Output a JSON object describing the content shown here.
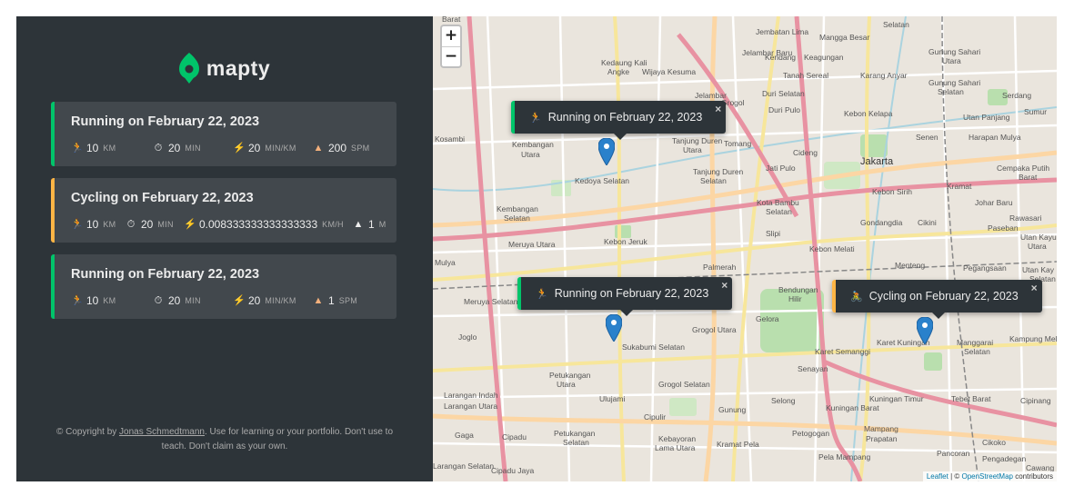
{
  "app": {
    "name": "mapty"
  },
  "colors": {
    "running": "#00c46a",
    "cycling": "#ffb545",
    "sidebar_bg": "#2d3439",
    "card_bg": "#42484d"
  },
  "workouts": [
    {
      "type": "running",
      "title": "Running on February 22, 2023",
      "stats": [
        {
          "icon": "running-icon",
          "value": "10",
          "unit": "km"
        },
        {
          "icon": "stopwatch-icon",
          "value": "20",
          "unit": "min"
        },
        {
          "icon": "lightning-icon",
          "value": "20",
          "unit": "min/km"
        },
        {
          "icon": "footprint-icon",
          "value": "200",
          "unit": "spm"
        }
      ]
    },
    {
      "type": "cycling",
      "title": "Cycling on February 22, 2023",
      "stats": [
        {
          "icon": "running-icon",
          "value": "10",
          "unit": "km"
        },
        {
          "icon": "stopwatch-icon",
          "value": "20",
          "unit": "min"
        },
        {
          "icon": "lightning-icon",
          "value": "0.008333333333333333",
          "unit": "km/h"
        },
        {
          "icon": "mountain-icon",
          "value": "1",
          "unit": "m"
        }
      ]
    },
    {
      "type": "running",
      "title": "Running on February 22, 2023",
      "stats": [
        {
          "icon": "running-icon",
          "value": "10",
          "unit": "km"
        },
        {
          "icon": "stopwatch-icon",
          "value": "20",
          "unit": "min"
        },
        {
          "icon": "lightning-icon",
          "value": "20",
          "unit": "min/km"
        },
        {
          "icon": "footprint-icon",
          "value": "1",
          "unit": "spm"
        }
      ]
    }
  ],
  "copyright": {
    "prefix": "© Copyright by ",
    "author": "Jonas Schmedtmann",
    "suffix": ". Use for learning or your portfolio. Don't use to teach. Don't claim as your own."
  },
  "map": {
    "zoom_in": "+",
    "zoom_out": "−",
    "popups": [
      {
        "type": "running",
        "text": "Running on February 22, 2023",
        "close": "×"
      },
      {
        "type": "running",
        "text": "Running on February 22, 2023",
        "close": "×"
      },
      {
        "type": "cycling",
        "text": "Cycling on February 22, 2023",
        "close": "×"
      }
    ],
    "attribution": {
      "leaflet": "Leaflet",
      "sep": " | © ",
      "osm": "OpenStreetMap",
      "contrib": " contributors"
    },
    "labels": [
      "Barat",
      "Jembatan Lima",
      "Mangga Besar",
      "Selatan",
      "Gunung Sahari Utara",
      "Jelambar Baru",
      "Kedaung Kali Angke",
      "Wijaya Kesuma",
      "Kendang",
      "Keagungan",
      "Tanah Sereal",
      "Karang Anyar",
      "Gunung Sahari Selatan",
      "Serdang",
      "Sumur",
      "Jelambar",
      "Duri Selatan",
      "Grogol",
      "Duri Pulo",
      "Kebon Kelapa",
      "Utan Panjang",
      "Kosambi",
      "Kembangan Utara",
      "Tanjung Duren Utara",
      "Tomang",
      "Cideng",
      "Harapan Mulya",
      "Jakarta",
      "Senen",
      "Cempaka Putih Barat",
      "Kedoya Selatan",
      "Tanjung Duren Selatan",
      "Jati Pulo",
      "Kebon Sirih",
      "Kramat",
      "Johar Baru",
      "Kembangan Selatan",
      "Kota Bambu Selatan",
      "Gondangdia",
      "Cikini",
      "Rawasari",
      "Paseban",
      "Meruya Utara",
      "Kebon Jeruk",
      "Slipi",
      "Kebon Melati",
      "Utan Kayu Utara",
      "Mulya",
      "Palmerah",
      "Menteng",
      "Pegangsaan",
      "Utan Kayu Selatan",
      "Meruya Selatan",
      "Bendungan Hilir",
      "Gelora",
      "Grogol Utara",
      "Joglo",
      "Sukabumi Selatan",
      "Karet Semanggi",
      "Karet Kuningan",
      "Manggarai Selatan",
      "Kampung Melayu",
      "Senayan",
      "Petukangan Utara",
      "Grogol Selatan",
      "Larangan Indah",
      "Larangan Utara",
      "Ulujami",
      "Selong",
      "Kuningan Barat",
      "Kuningan Timur",
      "Tebet Barat",
      "Cipinang",
      "Cipulir",
      "Gunung",
      "Petogogan",
      "Mampang Prapatan",
      "Pancoran",
      "Cikoko",
      "Gaga",
      "Cipadu",
      "Petukangan Selatan",
      "Kebayoran Lama Utara",
      "Kramat Pela",
      "Pela Mampang",
      "Pengadegan",
      "Larangan Selatan",
      "Cipadu Jaya",
      "Cawang"
    ]
  }
}
